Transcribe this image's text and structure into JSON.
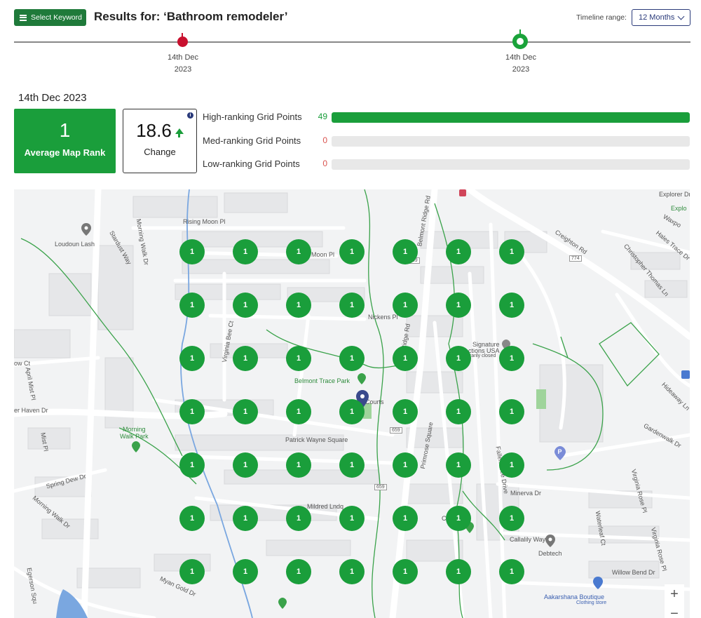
{
  "header": {
    "select_keyword_label": "Select Keyword",
    "results_title": "Results for: ‘Bathroom remodeler’",
    "timeline_range_label": "Timeline range:",
    "timeline_range_value": "12 Months"
  },
  "timeline": {
    "points": [
      {
        "date_line1": "14th Dec",
        "date_line2": "2023",
        "status": "red"
      },
      {
        "date_line1": "14th Dec",
        "date_line2": "2023",
        "status": "green-selected"
      }
    ]
  },
  "summary": {
    "date": "14th Dec 2023",
    "average_map_rank": "1",
    "average_map_rank_label": "Average Map Rank",
    "change_value": "18.6",
    "change_label": "Change",
    "change_direction": "up"
  },
  "grid_points": [
    {
      "label": "High-ranking Grid Points",
      "count": "49",
      "fraction": 1.0,
      "color": "#1a9e3b",
      "count_color": "#1a9e3b"
    },
    {
      "label": "Med-ranking Grid Points",
      "count": "0",
      "fraction": 0.0,
      "color": "#f0a020",
      "count_color": "#d9534f"
    },
    {
      "label": "Low-ranking Grid Points",
      "count": "0",
      "fraction": 0.0,
      "color": "#c8102e",
      "count_color": "#d9534f"
    }
  ],
  "map": {
    "grid_rank_value": "1",
    "grid_rows": 7,
    "grid_cols": 7,
    "labels": {
      "loudoun_lash": "Loudoun Lash",
      "rising_moon": "Rising Moon Pl",
      "stardust_way": "Stardust Way",
      "morning_walk_dr": "Morning Walk Dr",
      "moon_pl": "Moon Pl",
      "belmont_ridge_rd": "Belmont Ridge Rd",
      "nickens_pl": "Nickens Pl",
      "ridge_rd": "Ridge Rd",
      "virginia_bee_ct": "Virginia Bee Ct",
      "signature_usa": "Signature",
      "signature_usa2": "ctions USA",
      "temp_closed": "rarily closed",
      "belmont_trace_park": "Belmont Trace Park",
      "courts": "s Courts",
      "primrose_sq": "Primrose Square",
      "morning_walk_park1": "Morning",
      "morning_walk_park2": "Walk Park",
      "april_mist_pl": "April Mist Pl",
      "patrick_wayne_sq": "Patrick Wayne Square",
      "haven_dr": "er Haven Dr",
      "spring_dew_dr": "Spring Dew Dr",
      "mildred_ln": "Mildred Lndq",
      "minerva_dr": "Minerva Dr",
      "fallen_tree_dr": "Fallen Tree Drive",
      "creighton_rd": "Creighton Rd",
      "explorer_dr": "Explorer Dr",
      "explo": "Explo",
      "waxpool": "Waxpo",
      "hales_trace": "Hales Trace Dr",
      "christopher_thomas": "Christopher Thomas Ln",
      "gardenwalk_dr": "Gardenwalk Dr",
      "hideaway_ln": "Hideaway Ln",
      "callalily_way": "Callalily Way",
      "debtech": "Debtech",
      "willow_bend": "Willow Bend Dr",
      "aakarshana": "Aakarshana Boutique",
      "clothing_store": "Clothing store",
      "myan_gold_dr": "Myan Gold Dr",
      "waterleaf_ct": "Waterleaf Ct",
      "virginia_rose_pl": "Virginia Rose Pl",
      "virginia_rose_pl2": "Virginia Rose Pl",
      "chk_park": "C    Park",
      "route_659": "659",
      "route_774": "774",
      "ow_ct": "ow Ct",
      "m_pl": "Mist Pl",
      "rg_pl": "Rising Moon Pl",
      "morning_walk_dr2": "Morning Walk Dr",
      "egerson_sq": "Egerson Squ",
      "zoom_in": "+",
      "zoom_out": "−"
    }
  }
}
